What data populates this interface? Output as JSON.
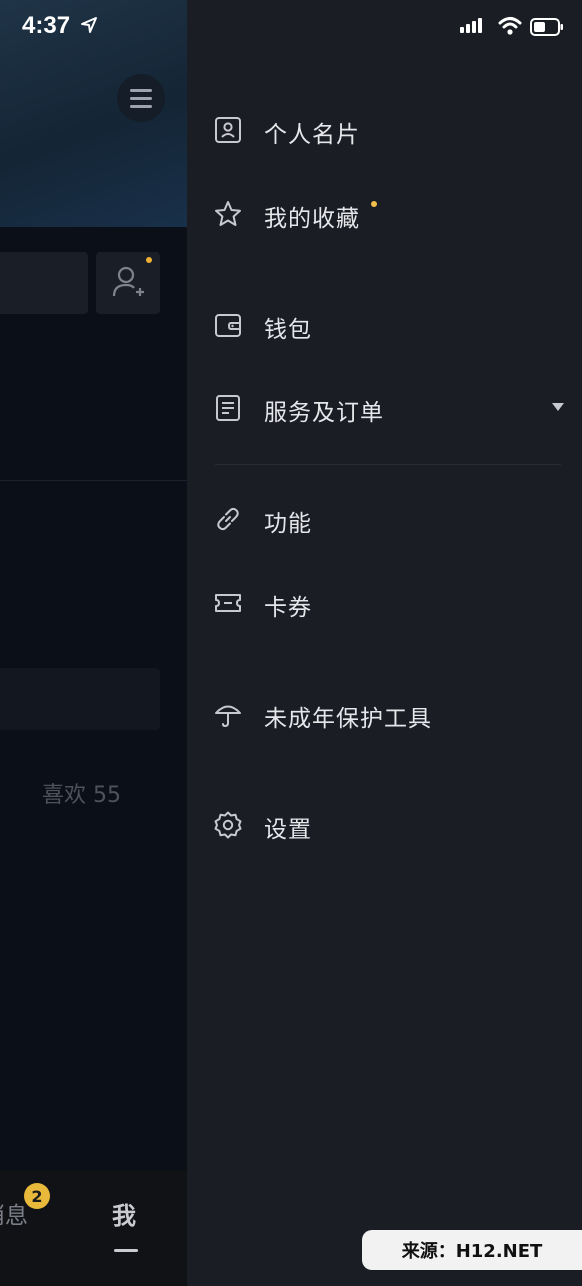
{
  "status_bar": {
    "time": "4:37",
    "icons": [
      "location-arrow-icon",
      "signal-icon",
      "wifi-icon",
      "battery-icon"
    ]
  },
  "background": {
    "likes": "喜欢 55",
    "tabs": {
      "messages_label": "消息",
      "messages_badge": "2",
      "me_label": "我"
    }
  },
  "drawer": {
    "items": [
      {
        "label": "个人名片",
        "icon": "contact-card-icon"
      },
      {
        "label": "我的收藏",
        "icon": "star-icon"
      },
      {
        "label": "钱包",
        "icon": "wallet-icon"
      },
      {
        "label": "服务及订单",
        "icon": "document-icon"
      },
      {
        "label": "功能",
        "icon": "link-icon"
      },
      {
        "label": "卡券",
        "icon": "ticket-icon"
      },
      {
        "label": "未成年保护工具",
        "icon": "umbrella-icon"
      },
      {
        "label": "设置",
        "icon": "gear-icon"
      }
    ]
  },
  "watermark": {
    "text": "来源：H12.NET"
  },
  "colors": {
    "drawer_bg": "#1b1d24",
    "badge": "#e8b93a",
    "dot": "#f2c04a"
  }
}
